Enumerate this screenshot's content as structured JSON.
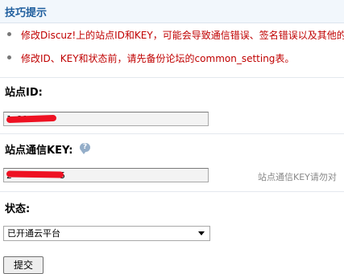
{
  "tips": {
    "title": "技巧提示",
    "items": [
      "修改Discuz!上的站点ID和KEY，可能会导致通信错误、签名错误以及其他的",
      "修改ID、KEY和状态前，请先备份论坛的common_setting表。"
    ]
  },
  "form": {
    "site_id": {
      "label": "站点ID:",
      "value": "1·21·"
    },
    "site_key": {
      "label": "站点通信KEY:",
      "help_icon": "speech-bubble-icon",
      "value": "2·········5",
      "hint": "站点通信KEY请勿对"
    },
    "status": {
      "label": "状态:",
      "selected": "已开通云平台"
    },
    "submit_label": "提交"
  },
  "colors": {
    "tips_title": "#1f5e9e",
    "tip_text": "#c00000",
    "redaction": "#ee1122",
    "header_bg": "#f2f7fc"
  }
}
